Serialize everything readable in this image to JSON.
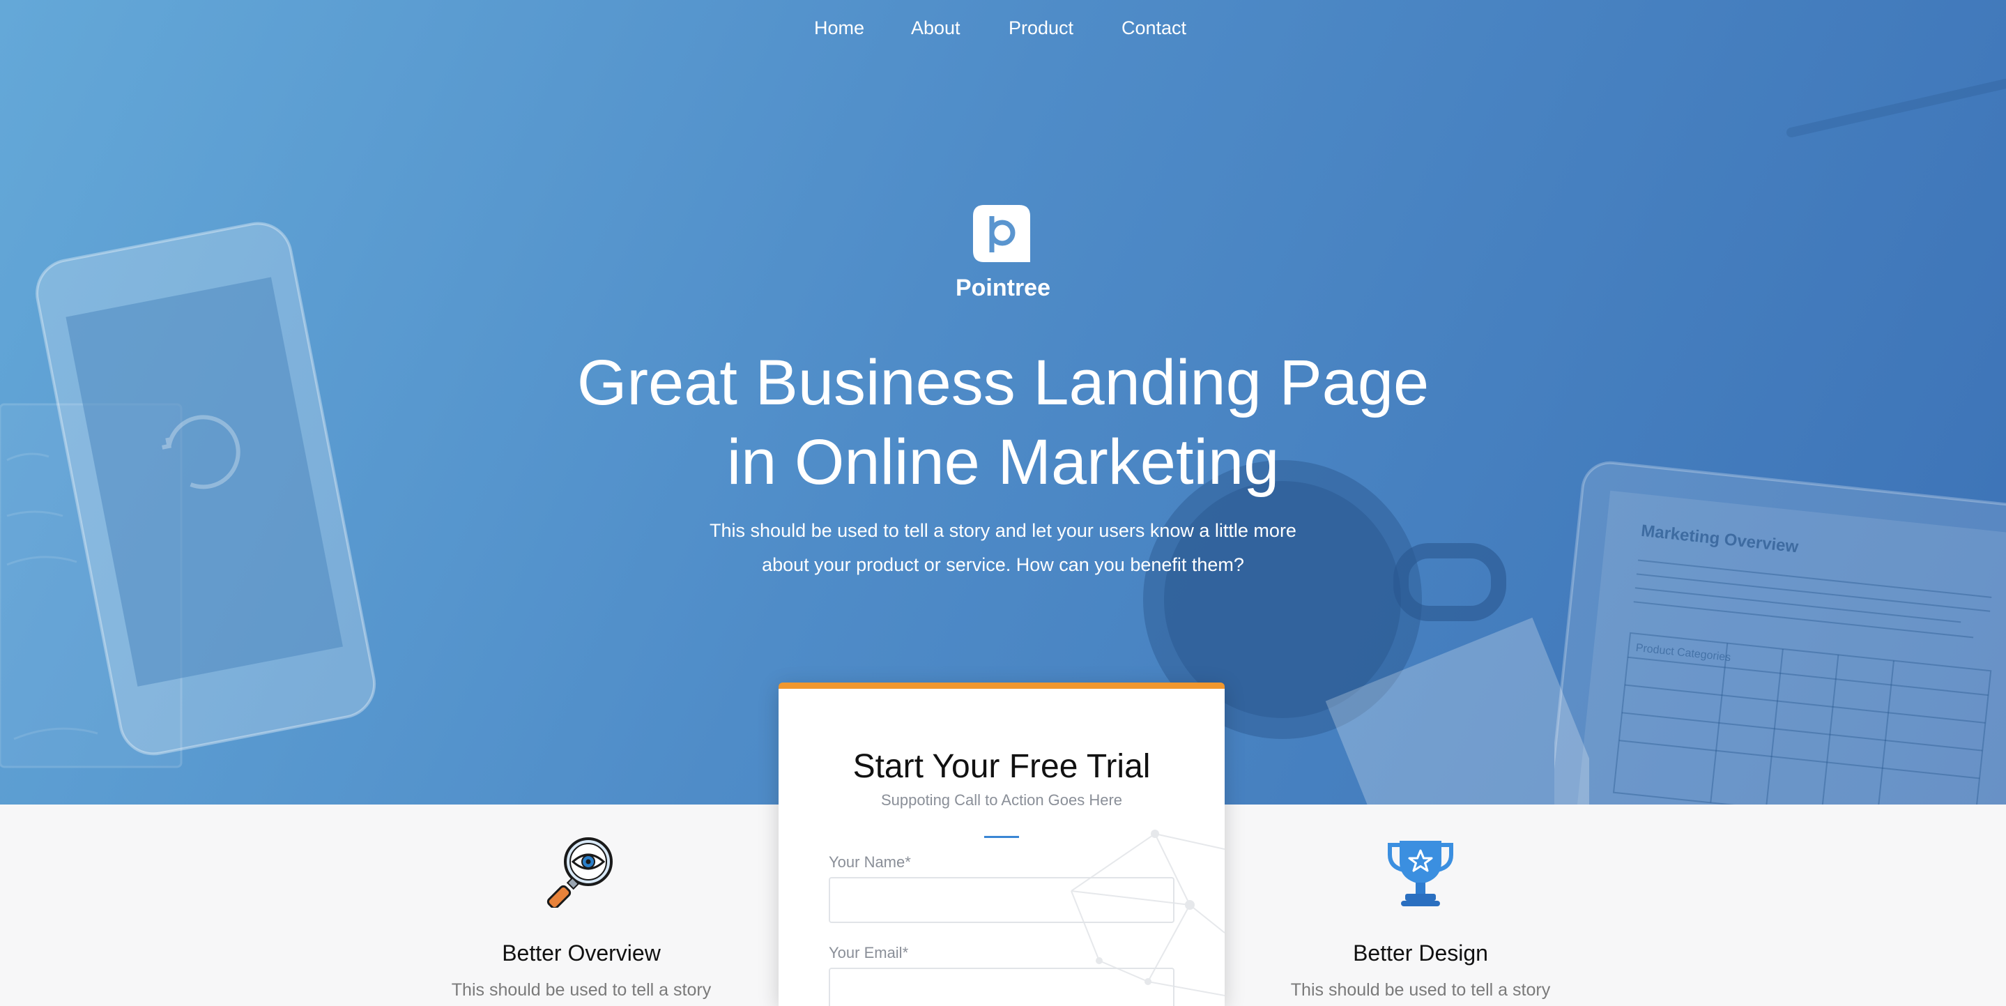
{
  "nav": {
    "items": [
      {
        "label": "Home"
      },
      {
        "label": "About"
      },
      {
        "label": "Product"
      },
      {
        "label": "Contact"
      }
    ]
  },
  "hero": {
    "logo_icon": "pointree-logo-icon",
    "brand_name": "Pointree",
    "headline_line1": "Great Business Landing Page",
    "headline_line2": "in Online Marketing",
    "subtext_line1": "This should be used to tell a story and let your users know a little more",
    "subtext_line2": "about your product or service. How can you benefit them?",
    "background_image_text": {
      "tablet_heading": "Marketing Overview",
      "tablet_table_header": "Product Categories"
    }
  },
  "trial_form": {
    "title": "Start Your Free Trial",
    "subtitle": "Suppoting Call to Action Goes Here",
    "name_label": "Your Name*",
    "name_value": "",
    "email_label": "Your Email*",
    "email_value": ""
  },
  "features": [
    {
      "icon": "magnifier-eye-icon",
      "title": "Better Overview",
      "text": "This should be used to tell a story"
    },
    {
      "icon": "trophy-icon",
      "title": "Better Design",
      "text": "This should be used to tell a story"
    }
  ],
  "colors": {
    "hero_gradient_start": "#64a8d8",
    "hero_gradient_end": "#3c72b6",
    "card_accent": "#f0972e",
    "divider_accent": "#3a86d4",
    "band_background": "#f7f7f8"
  }
}
